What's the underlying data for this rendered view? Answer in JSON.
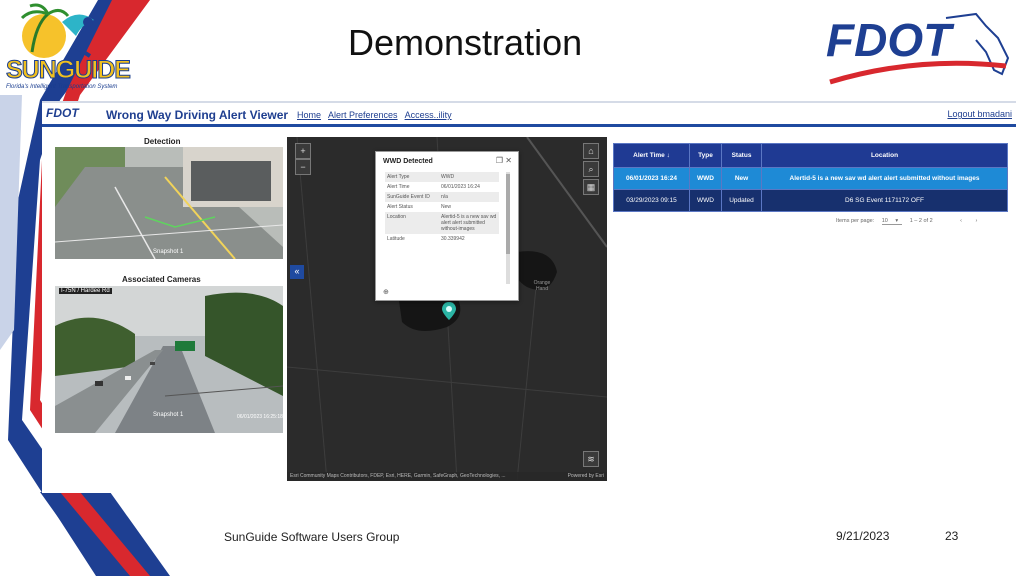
{
  "slide": {
    "title": "Demonstration",
    "sunguide_logo_text": "SUNGUIDE",
    "sunguide_tagline": "Florida's Intelligent Transportation System",
    "fdot_logo_text": "FDOT",
    "footer_text": "SunGuide Software Users Group",
    "footer_date": "9/21/2023",
    "page_number": "23"
  },
  "app": {
    "brand": "FDOT",
    "title": "Wrong Way Driving Alert Viewer",
    "nav": [
      "Home",
      "Alert Preferences",
      "Access..ility"
    ],
    "logout": "Logout bmadani"
  },
  "detection": {
    "label": "Detection",
    "snapshot_caption": "Snapshot 1"
  },
  "cameras": {
    "label": "Associated Cameras",
    "camera_caption": "I-75N / Hardee Rd",
    "snapshot_caption": "Snapshot 1",
    "timestamp": "06/01/2023 16:25:18"
  },
  "map": {
    "zoom_in": "+",
    "zoom_out": "−",
    "collapse_icon": "double-chevron-left-icon",
    "lake_label": "Orange Hand",
    "attribution_left": "Esri Community Maps Contributors, FDEP, Esri, HERE, Garmin, SafeGraph, GeoTechnologies, ...",
    "attribution_right": "Powered by Esri"
  },
  "popup": {
    "title": "WWD Detected",
    "rows": [
      {
        "label": "Alert Type",
        "value": "WWD"
      },
      {
        "label": "Alert Time",
        "value": "06/01/2023 16:24"
      },
      {
        "label": "SunGuide Event ID",
        "value": "n/a"
      },
      {
        "label": "Alert Status",
        "value": "New"
      },
      {
        "label": "Location",
        "value": "Alertid-5 is a new sav wd alert alert submitted without-images"
      },
      {
        "label": "Latitude",
        "value": "30.339942"
      }
    ]
  },
  "alerts_table": {
    "headers": [
      "Alert Time ↓",
      "Type",
      "Status",
      "Location"
    ],
    "rows": [
      [
        "06/01/2023 16:24",
        "WWD",
        "New",
        "Alertid-5 is a new sav wd alert alert submitted without images"
      ],
      [
        "03/29/2023 09:15",
        "WWD",
        "Updated",
        "D6 SG Event 1171172 OFF"
      ]
    ],
    "items_per_page_label": "Items per page:",
    "items_per_page_value": "10",
    "range_label": "1 – 2 of 2"
  },
  "colors": {
    "fdot_blue": "#1f3f90",
    "table_header": "#1f3a93",
    "row_selected": "#1e8ad6",
    "row_normal": "#17306e",
    "map_bg": "#2b2b2b",
    "marker": "#2bb5a5"
  }
}
